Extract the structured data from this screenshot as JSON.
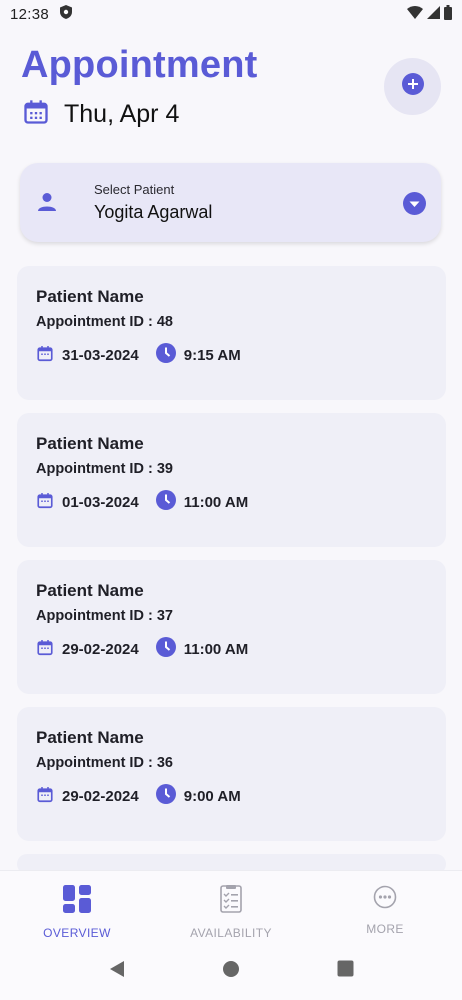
{
  "status_bar": {
    "time": "12:38"
  },
  "header": {
    "title": "Appointment",
    "date": "Thu, Apr 4"
  },
  "patient_select": {
    "caption": "Select Patient",
    "value": "Yogita Agarwal"
  },
  "appointments": [
    {
      "name": "Patient Name",
      "id_label": "Appointment ID : 48",
      "date": "31-03-2024",
      "time": "9:15 AM"
    },
    {
      "name": "Patient Name",
      "id_label": "Appointment ID : 39",
      "date": "01-03-2024",
      "time": "11:00 AM"
    },
    {
      "name": "Patient Name",
      "id_label": "Appointment ID : 37",
      "date": "29-02-2024",
      "time": "11:00 AM"
    },
    {
      "name": "Patient Name",
      "id_label": "Appointment ID : 36",
      "date": "29-02-2024",
      "time": "9:00 AM"
    }
  ],
  "bottom_nav": [
    {
      "label": "OVERVIEW",
      "icon": "dashboard-icon",
      "active": true
    },
    {
      "label": "AVAILABILITY",
      "icon": "checklist-icon",
      "active": false
    },
    {
      "label": "MORE",
      "icon": "more-icon",
      "active": false
    }
  ],
  "colors": {
    "accent": "#5a5bd6",
    "card_bg": "#efeff7",
    "select_bg": "#e8e7f7"
  }
}
